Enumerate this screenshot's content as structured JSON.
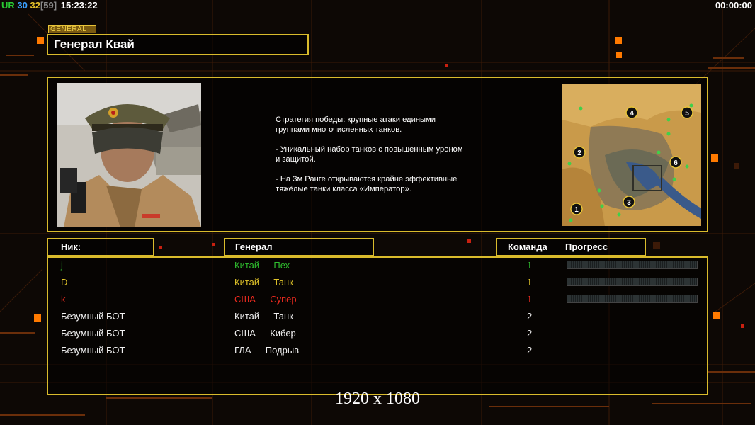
{
  "top_bar": {
    "ur": "UR",
    "stat1": "30",
    "stat2": "32",
    "stat3": "[59]",
    "clock": "15:23:22",
    "timer": "00:00:00"
  },
  "general": {
    "tag": "GENERAL",
    "name": "Генерал Квай",
    "description": "Стратегия победы: крупные атаки едиными\n группами многочисленных танков.\n\n- Уникальный набор танков с повышенным уроном\n и защитой.\n\n- На 3м Ранге открываются крайне эффективные\n тяжёлые танки класса «Император»."
  },
  "map": {
    "start_positions": [
      "1",
      "2",
      "3",
      "4",
      "5",
      "6"
    ]
  },
  "table": {
    "headers": {
      "nick": "Ник:",
      "general": "Генерал",
      "team": "Команда",
      "progress": "Прогресс"
    },
    "players": [
      {
        "nick": "j",
        "general": "Китай — Пех",
        "team": "1",
        "color": "#2fbf2f",
        "progress": 0
      },
      {
        "nick": "D",
        "general": "Китай — Танк",
        "team": "1",
        "color": "#e3c62a",
        "progress": 0
      },
      {
        "nick": "k",
        "general": "США — Супер",
        "team": "1",
        "color": "#e82a1f",
        "progress": 0
      },
      {
        "nick": "Безумный БОТ",
        "general": "Китай — Танк",
        "team": "2",
        "color": "#f0f0f0"
      },
      {
        "nick": "Безумный БОТ",
        "general": "США — Кибер",
        "team": "2",
        "color": "#f0f0f0"
      },
      {
        "nick": "Безумный БОТ",
        "general": "ГЛА — Подрыв",
        "team": "2",
        "color": "#f0f0f0"
      }
    ]
  },
  "footer": {
    "resolution": "1920 x 1080"
  },
  "colors": {
    "frame": "#d9bb2c",
    "accent_orange": "#ff7a00",
    "background": "#0d0805"
  }
}
